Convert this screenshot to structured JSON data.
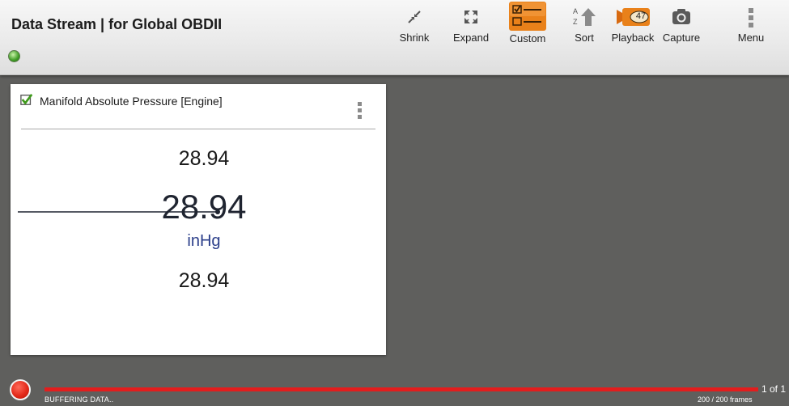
{
  "header": {
    "title": "Data Stream | for Global OBDII",
    "toolbar": {
      "shrink": "Shrink",
      "expand": "Expand",
      "custom": "Custom",
      "sort": "Sort",
      "playback": "Playback",
      "playback_badge": "47",
      "capture": "Capture",
      "menu": "Menu"
    }
  },
  "card": {
    "title": "Manifold Absolute Pressure [Engine]",
    "checked": true,
    "max_value": "28.94",
    "current_value": "28.94",
    "unit": "inHg",
    "min_value": "28.94"
  },
  "footer": {
    "buffer_status": "BUFFERING DATA..",
    "frames": "200 / 200 frames",
    "page_indicator": "1 of 1",
    "progress": 1.0
  },
  "colors": {
    "custom_accent": "#e9811a",
    "record_red": "#e32a1a",
    "progress_red": "#e31d1d",
    "unit_blue": "#2b3e8a",
    "background": "#5f5f5d"
  },
  "icons": {
    "shrink": "shrink-arrows-icon",
    "expand": "expand-arrows-icon",
    "custom": "custom-list-icon",
    "sort": "sort-az-icon",
    "playback": "video-camera-icon",
    "capture": "camera-icon",
    "menu": "vertical-dots-icon"
  }
}
